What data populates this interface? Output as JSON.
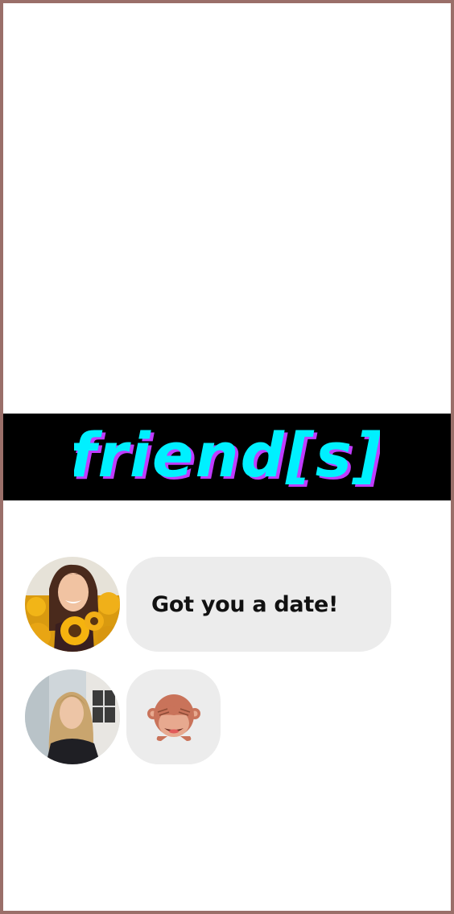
{
  "banner": {
    "logo_text": "friend[s]",
    "background": "#000000",
    "text_color": "#00f0ff",
    "shadow_color": "#c03cff"
  },
  "messages": [
    {
      "avatar": "girl-with-sunflowers-avatar",
      "text": "Got you a date!"
    },
    {
      "avatar": "blonde-girl-avatar",
      "emoji": "see-no-evil-monkey-icon",
      "emoji_char": "🙈"
    }
  ],
  "colors": {
    "frame": "#9a6f69",
    "bubble": "#ececec",
    "monkey": "#c9735a"
  }
}
